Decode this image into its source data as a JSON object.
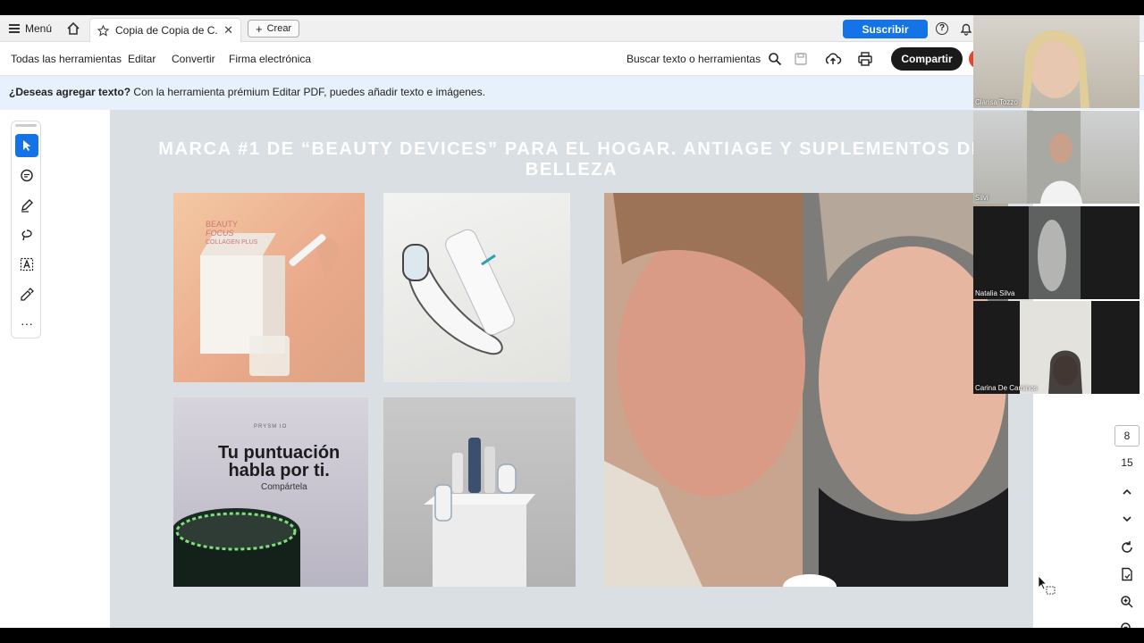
{
  "tabbar": {
    "menu_label": "Menú",
    "tab_title": "Copia de Copia de C...",
    "crear_label": "Crear",
    "subscribe_label": "Suscribir"
  },
  "toolbar": {
    "items": [
      "Todas las herramientas",
      "Editar",
      "Convertir",
      "Firma electrónica"
    ],
    "search_label": "Buscar texto o herramientas",
    "share_label": "Compartir"
  },
  "banner": {
    "bold": "¿Deseas agregar texto?",
    "text": " Con la herramienta prémium Editar PDF, puedes añadir texto e imágenes."
  },
  "document": {
    "heading": "MARCA #1 DE “BEAUTY DEVICES” PARA EL HOGAR. ANTIAGE Y SUPLEMENTOS DE BELLEZA",
    "ad_brand": "PRYSM IO",
    "ad_tagline_1": "Tu puntuación",
    "ad_tagline_2": "habla por ti.",
    "ad_share": "Compártela",
    "box_brand_1": "BEAUTY",
    "box_brand_2": "FOCUS",
    "box_product": "COLLAGEN PLUS"
  },
  "pagenav": {
    "current_page": "8",
    "total_pages": "15"
  },
  "participants": [
    {
      "name": "Clarisa Tozzo"
    },
    {
      "name": "Silvi"
    },
    {
      "name": "Natalia Silva"
    },
    {
      "name": "Carina De Caminos"
    }
  ],
  "colors": {
    "accent": "#1473e6",
    "share_button": "#1a1a1a",
    "banner_bg": "#e6f1fb",
    "page_bg": "#d9dfe2"
  }
}
